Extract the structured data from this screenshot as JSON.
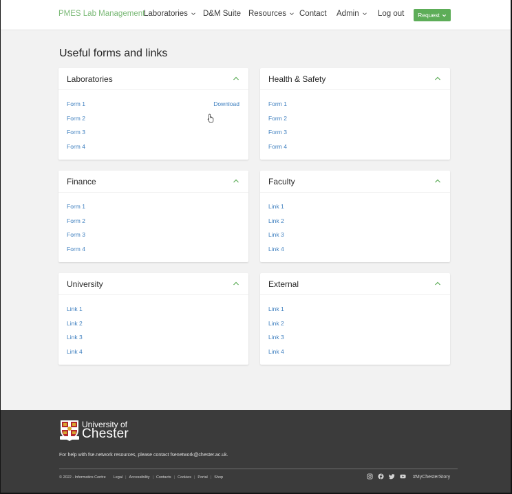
{
  "nav": {
    "brand": "PMES Lab Management",
    "items": [
      {
        "label": "Laboratories",
        "dropdown": true
      },
      {
        "label": "D&M Suite",
        "dropdown": false
      },
      {
        "label": "Resources",
        "dropdown": true
      },
      {
        "label": "Contact",
        "dropdown": false
      },
      {
        "label": "Admin",
        "dropdown": true
      },
      {
        "label": "Log out",
        "dropdown": false
      }
    ],
    "request_label": "Request"
  },
  "page": {
    "title": "Useful forms and links"
  },
  "cards": [
    {
      "title": "Laboratories",
      "links": [
        "Form 1",
        "Form 2",
        "Form 3",
        "Form 4"
      ],
      "download": "Download"
    },
    {
      "title": "Health & Safety",
      "links": [
        "Form 1",
        "Form 2",
        "Form 3",
        "Form 4"
      ]
    },
    {
      "title": "Finance",
      "links": [
        "Form 1",
        "Form 2",
        "Form 3",
        "Form 4"
      ]
    },
    {
      "title": "Faculty",
      "links": [
        "Link 1",
        "Link 2",
        "Link 3",
        "Link 4"
      ]
    },
    {
      "title": "University",
      "links": [
        "Link 1",
        "Link 2",
        "Link 3",
        "Link 4"
      ]
    },
    {
      "title": "External",
      "links": [
        "Link 1",
        "Link 2",
        "Link 3",
        "Link 4"
      ]
    }
  ],
  "footer": {
    "logo_top": "University of",
    "logo_bottom": "Chester",
    "help_prefix": "For help with fse.network resources, please contact ",
    "help_email": "fsenetwork@chester.ac.uk",
    "help_suffix": ".",
    "copyright": "© 2022 - Informatics Centre",
    "legal_links": [
      "Legal",
      "Accessibility",
      "Contacts",
      "Cookies",
      "Portal",
      "Shop"
    ],
    "social_icons": [
      "instagram-icon",
      "facebook-icon",
      "twitter-icon",
      "youtube-icon"
    ],
    "hashtag": "#MyChesterStory"
  },
  "colors": {
    "brand_green": "#7cba78",
    "button_green": "#5dad58",
    "link_blue": "#3e7fbf",
    "footer_bg": "#3b3b3b",
    "page_bg": "#f2f2f2"
  }
}
